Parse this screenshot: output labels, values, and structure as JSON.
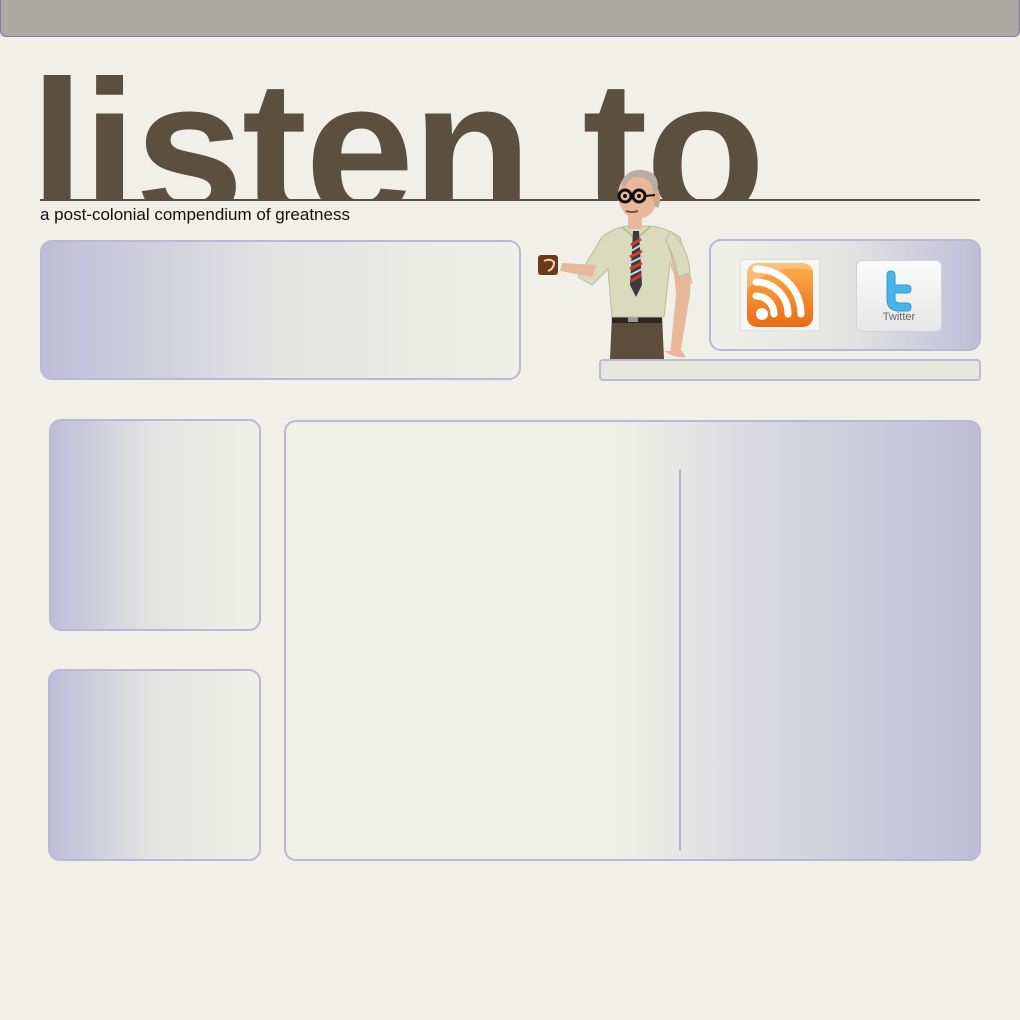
{
  "header": {
    "masthead_title": "listen to",
    "tagline": "a post-colonial compendium of greatness"
  },
  "social": {
    "rss_icon": "rss-feed-icon",
    "twitter_icon": "twitter-bird-icon",
    "twitter_label": "Twitter"
  },
  "mascot": {
    "icon": "man-with-coffee-mug"
  },
  "colors": {
    "masthead_brown": "#5c4f40",
    "background": "#f0f0e8",
    "panel_border": "#b9b8d6",
    "panel_tint": "#bebdd8",
    "topbar": "#aca9a0",
    "rss_orange": "#f7931e",
    "twitter_blue": "#4bb3e8"
  }
}
